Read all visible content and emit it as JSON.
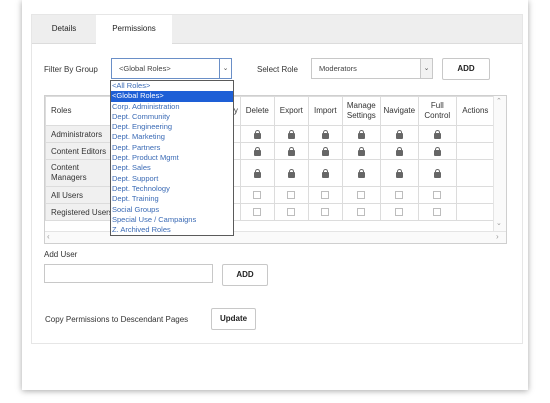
{
  "tabs": [
    {
      "label": "Details",
      "active": false
    },
    {
      "label": "Permissions",
      "active": true
    }
  ],
  "filter": {
    "label": "Filter By Group",
    "selected": "<Global Roles>",
    "options": [
      "<All Roles>",
      "<Global Roles>",
      "Corp. Administration",
      "Dept. Community",
      "Dept. Engineering",
      "Dept. Marketing",
      "Dept. Partners",
      "Dept. Product Mgmt",
      "Dept. Sales",
      "Dept. Support",
      "Dept. Technology",
      "Dept. Training",
      "Social Groups",
      "Special Use / Campaigns",
      "Z. Archived Roles"
    ],
    "highlighted_index": 1
  },
  "role": {
    "label": "Select Role",
    "selected": "Moderators",
    "add_label": "ADD"
  },
  "table": {
    "headers": {
      "roles": "Roles",
      "view_partial": "y",
      "delete": "Delete",
      "export": "Export",
      "import": "Import",
      "manage_line1": "Manage",
      "manage_line2": "Settings",
      "navigate": "Navigate",
      "full_line1": "Full",
      "full_line2": "Control",
      "actions": "Actions"
    },
    "rows": [
      {
        "name": "Administrators",
        "state": "locked"
      },
      {
        "name": "Content Editors",
        "state": "locked"
      },
      {
        "name": "Content Managers",
        "state": "locked"
      },
      {
        "name": "All Users",
        "state": "unchecked"
      },
      {
        "name": "Registered Users",
        "state": "unchecked"
      }
    ]
  },
  "add_user": {
    "label": "Add User",
    "value": "",
    "button": "ADD"
  },
  "copy": {
    "label": "Copy Permissions to Descendant Pages",
    "button": "Update"
  },
  "colors": {
    "highlight": "#1e5fd6",
    "option_text": "#3a6ab5",
    "tab_bar": "#eeeeee",
    "role_cell": "#f0f0f0"
  }
}
